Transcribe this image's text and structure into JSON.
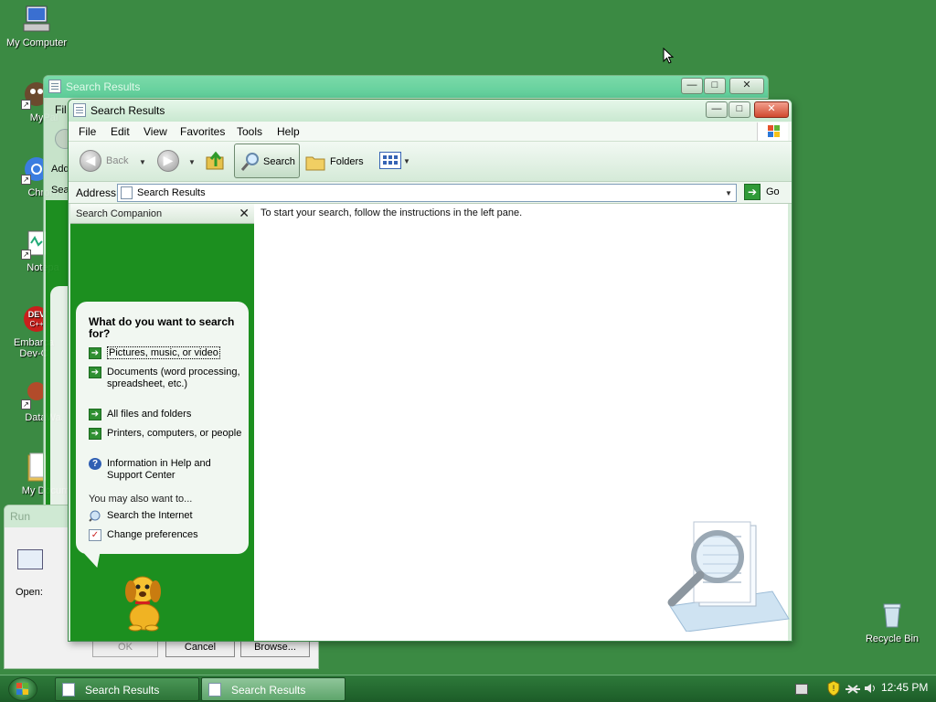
{
  "desktop": {
    "icons": [
      {
        "label": "My Computer"
      },
      {
        "label": "MyPal"
      },
      {
        "label": "Chrom"
      },
      {
        "label": "Notepa"
      },
      {
        "label": "Embarca Dev-C"
      },
      {
        "label": "DataWa"
      },
      {
        "label": "My Docum"
      },
      {
        "label": "Recycle Bin"
      }
    ]
  },
  "back_window": {
    "title": "Search Results",
    "menu_fragment": "Fil",
    "address_fragment": "Add",
    "search_fragment": "Sea"
  },
  "run_dialog": {
    "title": "Run",
    "open_label": "Open:",
    "buttons": [
      "OK",
      "Cancel",
      "Browse..."
    ]
  },
  "window": {
    "title": "Search Results",
    "controls": {
      "minimize": "—",
      "maximize": "□",
      "close": "✕"
    },
    "menu": [
      "File",
      "Edit",
      "View",
      "Favorites",
      "Tools",
      "Help"
    ],
    "toolbar": {
      "back": "Back",
      "search": "Search",
      "folders": "Folders"
    },
    "address": {
      "label": "Address",
      "value": "Search Results",
      "go": "Go"
    },
    "companion": {
      "header": "Search Companion",
      "close": "✕",
      "question": "What do you want to search for?",
      "options": [
        "Pictures, music, or video",
        "Documents (word processing, spreadsheet, etc.)",
        "All files and folders",
        "Printers, computers, or people",
        "Information in Help and Support Center"
      ],
      "also_label": "You may also want to...",
      "also": [
        "Search the Internet",
        "Change preferences"
      ]
    },
    "instructions": "To start your search, follow the instructions in the left pane."
  },
  "taskbar": {
    "tasks": [
      {
        "label": "Search Results",
        "active": false
      },
      {
        "label": "Search Results",
        "active": true
      }
    ],
    "clock": "12:45 PM"
  },
  "colors": {
    "desktop": "#3b8a43",
    "companion_green": "#1c8f1f"
  }
}
